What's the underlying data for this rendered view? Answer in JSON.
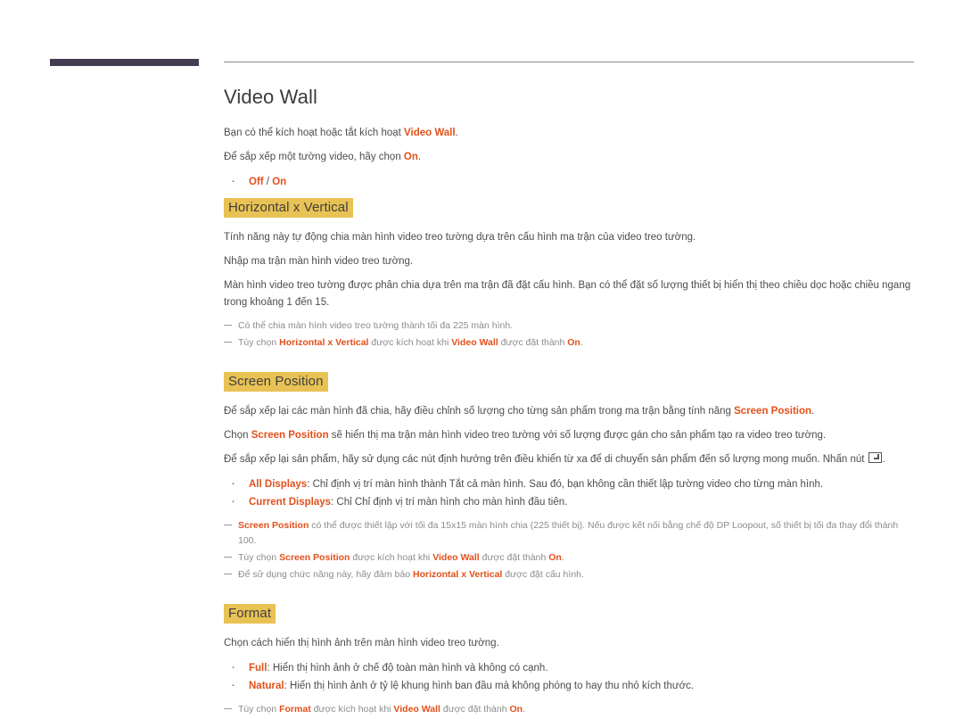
{
  "decor": {
    "left_bar_color": "#443d52",
    "rule_color": "#8a8a8a"
  },
  "colors": {
    "accent": "#e2501b",
    "highlight": "#e8c254",
    "body_text": "#4d4d4d",
    "note_text": "#8c8c8c"
  },
  "page": {
    "title": "Video Wall"
  },
  "intro": {
    "line1_pre": "Bạn có thể kích hoạt hoặc tắt kích hoạt ",
    "line1_term": "Video Wall",
    "line1_post": ".",
    "line2_pre": "Để sắp xếp một tường video, hãy chọn ",
    "line2_term": "On",
    "line2_post": ".",
    "bullet1_a": "Off",
    "bullet1_sep": " / ",
    "bullet1_b": "On"
  },
  "sections": [
    {
      "id": "horizontal-x-vertical",
      "title": "Horizontal x Vertical",
      "paragraphs": [
        "Tính năng này tự động chia màn hình video treo tường dựa trên cấu hình ma trận của video treo tường.",
        "Nhập ma trận màn hình video treo tường.",
        "Màn hình video treo tường được phân chia dựa trên ma trận đã đặt cấu hình. Bạn có thể đặt số lượng thiết bị hiển thị theo chiều dọc hoặc chiều ngang trong khoảng 1 đến 15."
      ],
      "notes": [
        {
          "parts": [
            {
              "t": "Có thể chia màn hình video treo tường thành tối đa 225 màn hình.",
              "s": "plain"
            }
          ]
        },
        {
          "parts": [
            {
              "t": "Tùy chọn ",
              "s": "plain"
            },
            {
              "t": "Horizontal x Vertical",
              "s": "accent"
            },
            {
              "t": " được kích hoạt khi ",
              "s": "plain"
            },
            {
              "t": "Video Wall",
              "s": "accent"
            },
            {
              "t": " được đặt thành ",
              "s": "plain"
            },
            {
              "t": "On",
              "s": "accent"
            },
            {
              "t": ".",
              "s": "plain"
            }
          ]
        }
      ]
    },
    {
      "id": "screen-position",
      "title": "Screen Position",
      "paragraphs": [],
      "rich_paragraphs": [
        [
          {
            "t": "Để sắp xếp lại các màn hình đã chia, hãy điều chỉnh số lượng cho từng sản phẩm trong ma trận bằng tính năng ",
            "s": "plain"
          },
          {
            "t": "Screen Position",
            "s": "accent"
          },
          {
            "t": ".",
            "s": "plain"
          }
        ],
        [
          {
            "t": "Chọn ",
            "s": "plain"
          },
          {
            "t": "Screen Position",
            "s": "accent"
          },
          {
            "t": " sẽ hiển thị ma trận màn hình video treo tường với số lượng được gán cho sản phẩm tạo ra video treo tường.",
            "s": "plain"
          }
        ],
        [
          {
            "t": "Để sắp xếp lại sản phẩm, hãy sử dụng các nút định hướng trên điều khiển từ xa để di chuyển sản phẩm đến số lượng mong muốn. Nhấn nút ",
            "s": "plain"
          },
          {
            "t": "",
            "s": "enter-key"
          },
          {
            "t": ".",
            "s": "plain"
          }
        ]
      ],
      "bullets": [
        {
          "term": "All Displays",
          "colon": ": ",
          "text": "Chỉ định vị trí màn hình thành Tắt cả màn hình. Sau đó, bạn không cần thiết lập tường video cho từng màn hình."
        },
        {
          "term": "Current Displays",
          "colon": ": ",
          "text": "Chỉ Chỉ định vị trí màn hình cho màn hình đầu tiên."
        }
      ],
      "notes": [
        {
          "parts": [
            {
              "t": "Screen Position",
              "s": "accent"
            },
            {
              "t": " có thể được thiết lập với tối đa 15x15 màn hình chia (225 thiết bị). Nếu được kết nối bằng chế độ DP Loopout, số thiết bị tối đa thay đổi thành 100.",
              "s": "plain"
            }
          ]
        },
        {
          "parts": [
            {
              "t": "Tùy chọn ",
              "s": "plain"
            },
            {
              "t": "Screen Position",
              "s": "accent"
            },
            {
              "t": " được kích hoạt khi ",
              "s": "plain"
            },
            {
              "t": "Video Wall",
              "s": "accent"
            },
            {
              "t": " được đặt thành ",
              "s": "plain"
            },
            {
              "t": "On",
              "s": "accent"
            },
            {
              "t": ".",
              "s": "plain"
            }
          ]
        },
        {
          "parts": [
            {
              "t": "Để sử dụng chức năng này, hãy đảm bảo ",
              "s": "plain"
            },
            {
              "t": "Horizontal x Vertical",
              "s": "accent"
            },
            {
              "t": " được đặt cấu hình.",
              "s": "plain"
            }
          ]
        }
      ]
    },
    {
      "id": "format",
      "title": "Format",
      "paragraphs": [
        "Chọn cách hiển thị hình ảnh trên màn hình video treo tường."
      ],
      "bullets": [
        {
          "term": "Full",
          "colon": ": ",
          "text": "Hiển thị hình ảnh ở chế độ toàn màn hình và không có cạnh."
        },
        {
          "term": "Natural",
          "colon": ": ",
          "text": "Hiển thị hình ảnh ở tỷ lệ khung hình ban đầu mà không phóng to hay thu nhỏ kích thước."
        }
      ],
      "notes": [
        {
          "parts": [
            {
              "t": "Tùy chọn ",
              "s": "plain"
            },
            {
              "t": "Format",
              "s": "accent"
            },
            {
              "t": " được kích hoạt khi ",
              "s": "plain"
            },
            {
              "t": "Video Wall",
              "s": "accent"
            },
            {
              "t": " được đặt thành ",
              "s": "plain"
            },
            {
              "t": "On",
              "s": "accent"
            },
            {
              "t": ".",
              "s": "plain"
            }
          ]
        }
      ]
    }
  ]
}
